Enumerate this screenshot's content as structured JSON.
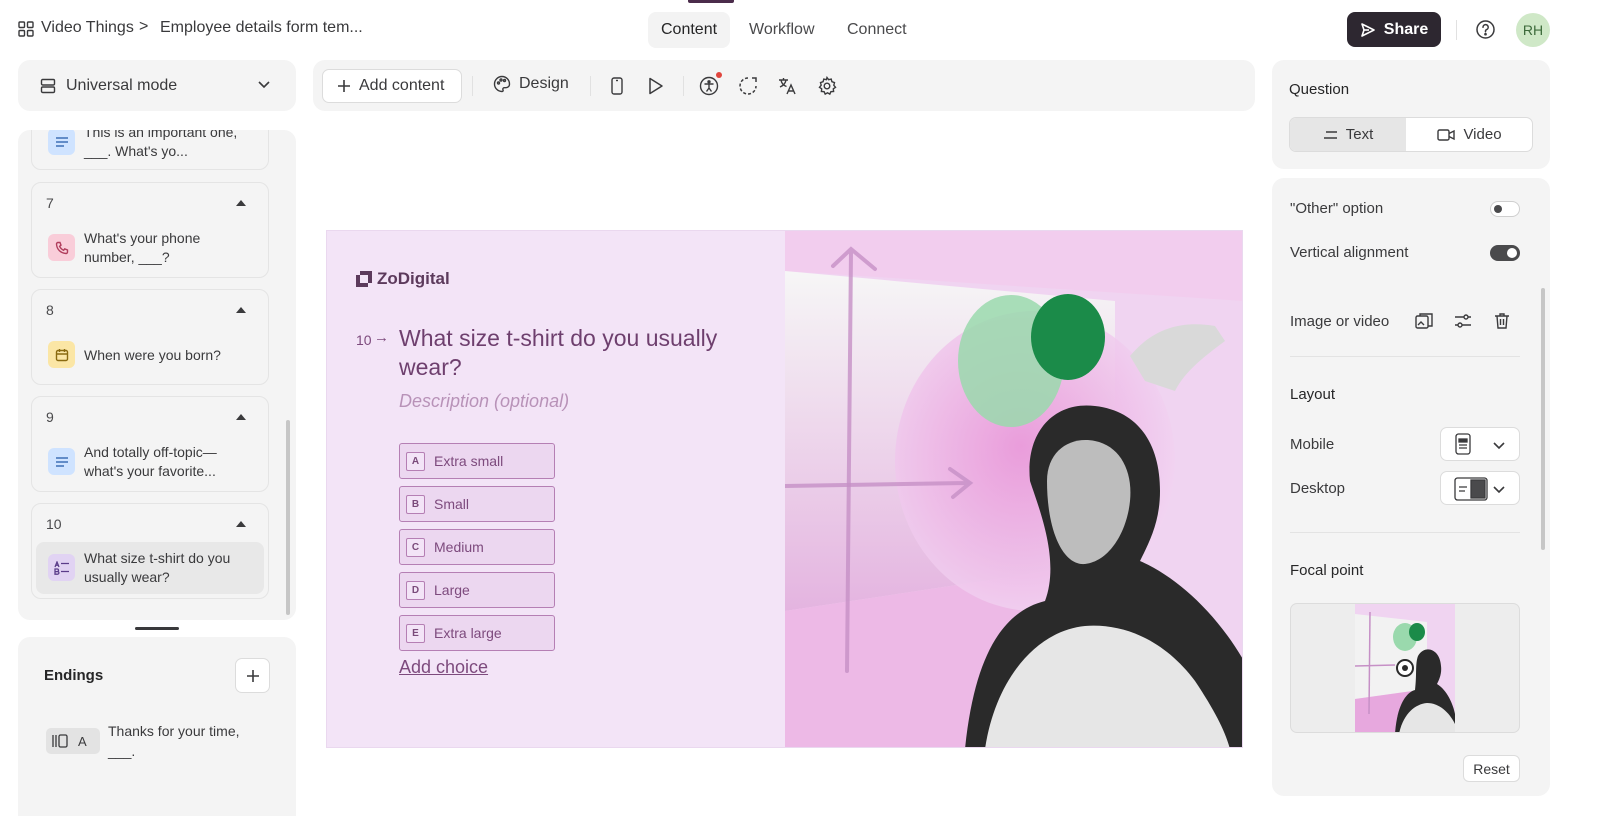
{
  "breadcrumb": {
    "workspace": "Video Things",
    "separator": ">",
    "form": "Employee details form tem..."
  },
  "nav_tabs": [
    {
      "label": "Content",
      "active": true
    },
    {
      "label": "Workflow",
      "active": false
    },
    {
      "label": "Connect",
      "active": false
    }
  ],
  "share_label": "Share",
  "avatar_initials": "RH",
  "mode_select": {
    "value": "Universal mode"
  },
  "toolbar": {
    "add_content": "Add content",
    "design": "Design"
  },
  "questions": [
    {
      "number": "",
      "text": "This is an important one, ___. What's yo...",
      "icon": "short-text-icon"
    },
    {
      "number": "7",
      "text": "What's your phone number, ___?",
      "icon": "phone-icon"
    },
    {
      "number": "8",
      "text": "When were you born?",
      "icon": "calendar-icon"
    },
    {
      "number": "9",
      "text": "And totally off-topic—what's your favorite...",
      "icon": "short-text-icon"
    },
    {
      "number": "10",
      "text": "What size t-shirt do you usually wear?",
      "icon": "multiple-choice-icon",
      "selected": true
    }
  ],
  "endings": {
    "title": "Endings",
    "items": [
      {
        "key": "A",
        "text": "Thanks for your time, ___."
      }
    ]
  },
  "canvas": {
    "brand": "ZoDigital",
    "question_number": "10",
    "arrow": "→",
    "question": "What size t-shirt do you usually wear?",
    "description_placeholder": "Description (optional)",
    "choices": [
      {
        "key": "A",
        "label": "Extra small"
      },
      {
        "key": "B",
        "label": "Small"
      },
      {
        "key": "C",
        "label": "Medium"
      },
      {
        "key": "D",
        "label": "Large"
      },
      {
        "key": "E",
        "label": "Extra large"
      }
    ],
    "add_choice": "Add choice"
  },
  "settings": {
    "question_label": "Question",
    "type_toggle": {
      "text": "Text",
      "video": "Video",
      "selected": "Text"
    },
    "other_option": {
      "label": "\"Other\" option",
      "on": false
    },
    "vertical_alignment": {
      "label": "Vertical alignment",
      "on": true
    },
    "image_or_video": "Image or video",
    "layout": "Layout",
    "mobile": "Mobile",
    "desktop": "Desktop",
    "focal_point": "Focal point",
    "reset": "Reset"
  },
  "colors": {
    "accent": "#2d2730",
    "canvas_bg": "#f3e4f7",
    "question_text": "#7d4a7d",
    "choice_border": "#b57fb4",
    "toggle_on": "#4a4a4c"
  }
}
